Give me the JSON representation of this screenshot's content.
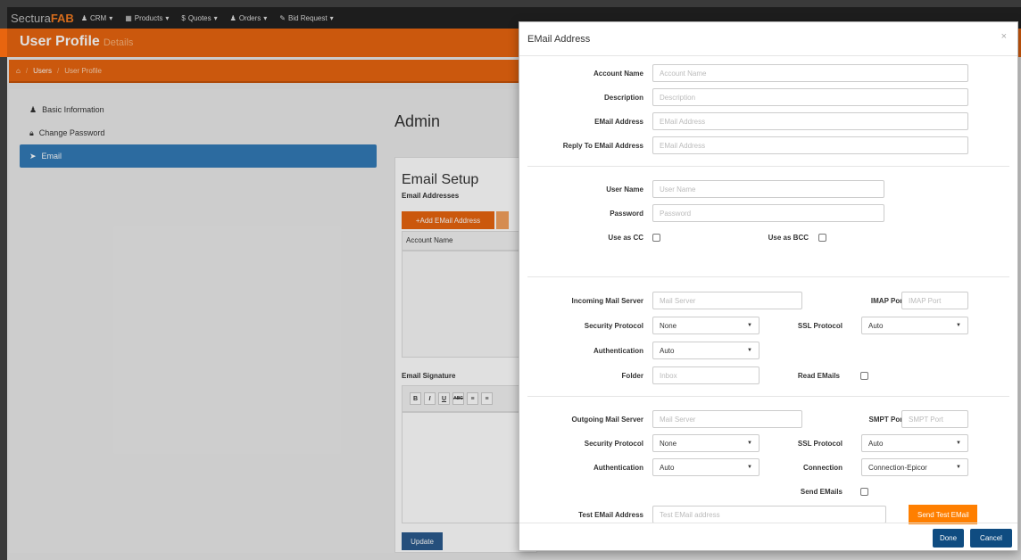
{
  "navbar": {
    "brand_prefix": "Sectura",
    "brand_suffix": "FAB",
    "items": [
      {
        "icon": "user-icon",
        "label": "CRM",
        "glyph": "♟"
      },
      {
        "icon": "list-icon",
        "label": "Products",
        "glyph": "▦"
      },
      {
        "icon": "dollar-icon",
        "label": "Quotes",
        "glyph": "$"
      },
      {
        "icon": "bell-icon",
        "label": "Orders",
        "glyph": "♟"
      },
      {
        "icon": "gavel-icon",
        "label": "Bid Request",
        "glyph": "✎"
      }
    ]
  },
  "header": {
    "title": "User Profile",
    "subtitle": "Details"
  },
  "breadcrumb": {
    "home_icon": "home-icon",
    "items": [
      "Users",
      "User Profile"
    ]
  },
  "sidebar": {
    "items": [
      {
        "icon": "user-icon",
        "label": "Basic Information",
        "active": false
      },
      {
        "icon": "lock-icon",
        "label": "Change Password",
        "active": false
      },
      {
        "icon": "send-icon",
        "label": "Email",
        "active": true
      }
    ]
  },
  "main": {
    "title": "Admin",
    "setup_title": "Email Setup",
    "email_addresses_label": "Email Addresses",
    "add_button": "+Add EMail Address",
    "account_name_header": "Account Name",
    "signature_label": "Email Signature",
    "editor_buttons": [
      "B",
      "I",
      "U",
      "ABC",
      "≡",
      "≡"
    ],
    "update_button": "Update"
  },
  "modal": {
    "title": "EMail Address",
    "close": "×",
    "account": {
      "account_name_label": "Account Name",
      "account_name_placeholder": "Account Name",
      "description_label": "Description",
      "description_placeholder": "Description",
      "email_label": "EMail Address",
      "email_placeholder": "EMail Address",
      "reply_to_label": "Reply To EMail Address",
      "reply_to_placeholder": "EMail Address"
    },
    "credentials": {
      "user_name_label": "User Name",
      "user_name_placeholder": "User Name",
      "password_label": "Password",
      "password_placeholder": "Password",
      "use_cc_label": "Use as CC",
      "use_bcc_label": "Use as BCC"
    },
    "incoming": {
      "server_label": "Incoming Mail Server",
      "server_placeholder": "Mail Server",
      "port_label": "IMAP Port",
      "port_placeholder": "IMAP Port",
      "security_label": "Security Protocol",
      "security_value": "None",
      "ssl_label": "SSL Protocol",
      "ssl_value": "Auto",
      "auth_label": "Authentication",
      "auth_value": "Auto",
      "folder_label": "Folder",
      "folder_placeholder": "Inbox",
      "read_label": "Read EMails"
    },
    "outgoing": {
      "server_label": "Outgoing Mail Server",
      "server_placeholder": "Mail Server",
      "port_label": "SMPT Port",
      "port_placeholder": "SMPT Port",
      "security_label": "Security Protocol",
      "security_value": "None",
      "ssl_label": "SSL Protocol",
      "ssl_value": "Auto",
      "auth_label": "Authentication",
      "auth_value": "Auto",
      "connection_label": "Connection",
      "connection_value": "Connection-Epicor",
      "send_label": "Send EMails",
      "test_label": "Test EMail Address",
      "test_placeholder": "Test EMail address",
      "send_test_button": "Send Test EMail"
    },
    "footer": {
      "done": "Done",
      "cancel": "Cancel"
    }
  }
}
